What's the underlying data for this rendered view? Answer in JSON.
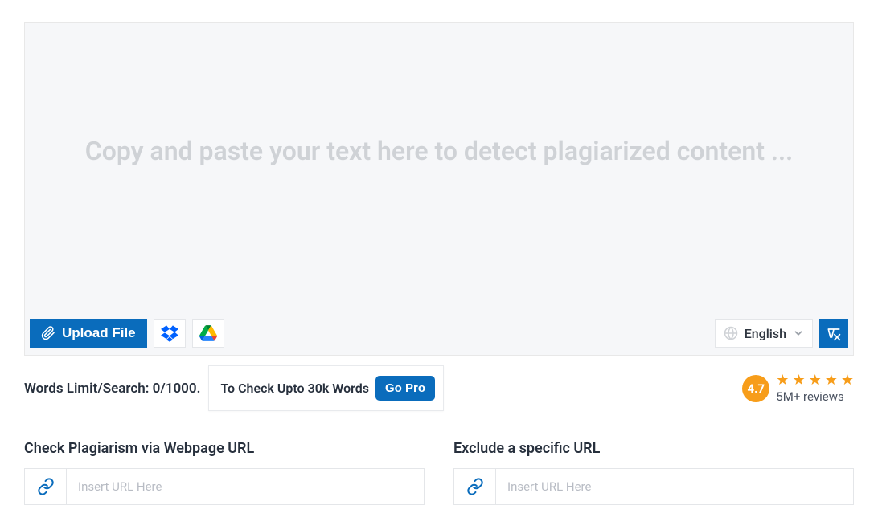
{
  "textarea": {
    "placeholder": "Copy and paste your text here to detect plagiarized content ..."
  },
  "controls": {
    "upload_label": "Upload File",
    "language_label": "English"
  },
  "limits": {
    "words_limit_label": "Words Limit/Search: 0/1000.",
    "pro_text": "To Check Upto 30k Words",
    "go_pro_label": "Go Pro"
  },
  "reviews": {
    "rating": "4.7",
    "count_label": "5M+ reviews"
  },
  "url_section": {
    "check_title": "Check Plagiarism via Webpage URL",
    "exclude_title": "Exclude a specific URL",
    "placeholder": "Insert URL Here"
  }
}
